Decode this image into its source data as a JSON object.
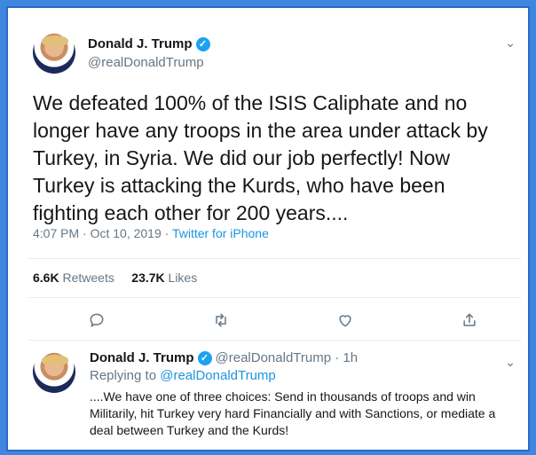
{
  "tweet": {
    "author_name": "Donald J. Trump",
    "handle": "@realDonaldTrump",
    "text": "We defeated 100% of the ISIS Caliphate and no longer have any troops in the area under attack by Turkey, in Syria. We did our job perfectly! Now Turkey is attacking the Kurds, who have been fighting each other for 200 years....",
    "time": "4:07 PM · Oct 10, 2019 · ",
    "source": "Twitter for iPhone",
    "retweets_count": "6.6K",
    "retweets_label": "Retweets",
    "likes_count": "23.7K",
    "likes_label": "Likes",
    "actions": [
      "reply-icon",
      "retweet-icon",
      "like-icon",
      "share-icon"
    ]
  },
  "reply": {
    "author_name": "Donald J. Trump",
    "handle_time": "@realDonaldTrump · 1h",
    "replying_prefix": "Replying to ",
    "replying_to": "@realDonaldTrump",
    "text": "....We have one of three choices: Send in thousands of troops and win Militarily, hit Turkey very hard Financially and with Sanctions, or mediate a deal between Turkey and the Kurds!"
  },
  "colors": {
    "frame": "#3f86e0",
    "verified": "#1da1f2",
    "link": "#1b95e0",
    "muted": "#657786"
  }
}
